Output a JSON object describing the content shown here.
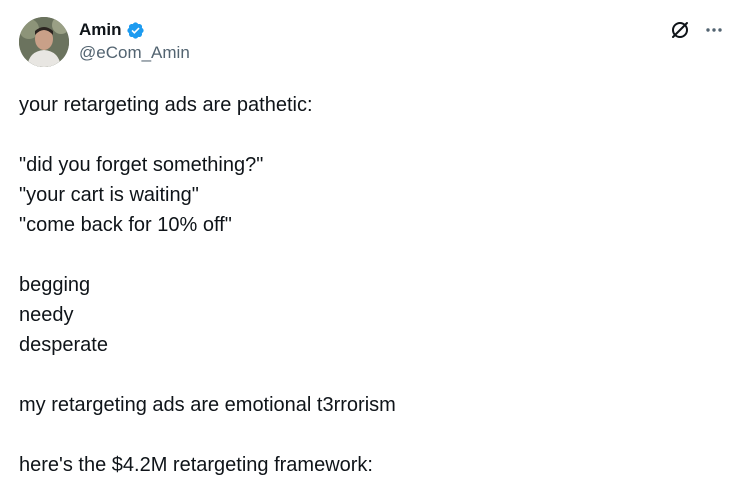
{
  "author": {
    "name": "Amin",
    "handle": "@eCom_Amin",
    "verified_color": "#1d9bf0"
  },
  "icons": {
    "verified": "verified-badge-icon",
    "grok": "grok-icon",
    "more": "more-options-icon"
  },
  "post": {
    "lines": [
      "your retargeting ads are pathetic:",
      "",
      "\"did you forget something?\"",
      "\"your cart is waiting\"",
      "\"come back for 10% off\"",
      "",
      "begging",
      "needy",
      "desperate",
      "",
      "my retargeting ads are emotional t3rrorism",
      "",
      "here's the $4.2M retargeting framework:"
    ]
  }
}
